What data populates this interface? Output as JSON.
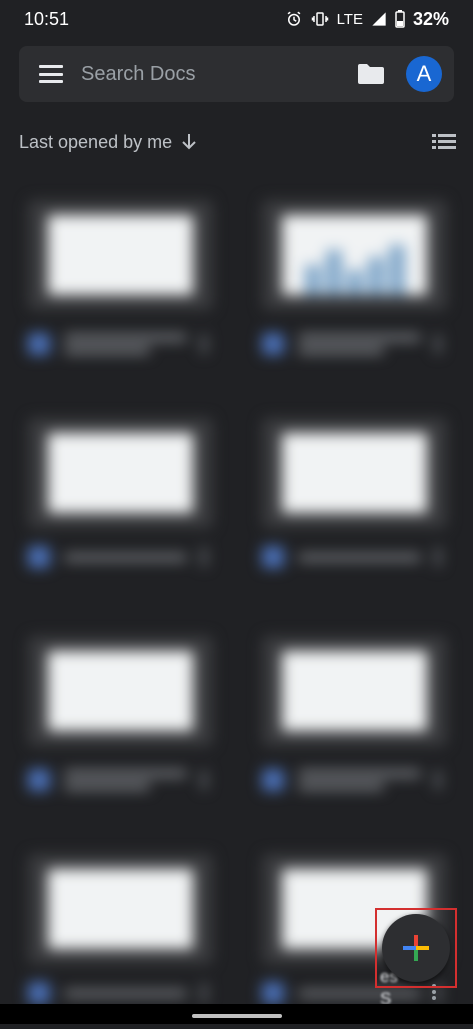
{
  "status_bar": {
    "time": "10:51",
    "network": "LTE",
    "battery": "32%"
  },
  "search": {
    "placeholder": "Search Docs",
    "avatar_letter": "A"
  },
  "sort": {
    "label": "Last opened by me"
  },
  "fab_peek_text": "es\nS",
  "documents": [
    {
      "thumbnail": "doc"
    },
    {
      "thumbnail": "chart"
    },
    {
      "thumbnail": "doc"
    },
    {
      "thumbnail": "doc"
    },
    {
      "thumbnail": "doc"
    },
    {
      "thumbnail": "doc"
    },
    {
      "thumbnail": "doc"
    },
    {
      "thumbnail": "doc"
    }
  ],
  "colors": {
    "background": "#202124",
    "search_bar": "#2d2e31",
    "avatar": "#1967d2",
    "highlight_box": "#d32f2f",
    "fab_plus": [
      "#4285f4",
      "#ea4335",
      "#fbbc04",
      "#34a853"
    ]
  }
}
